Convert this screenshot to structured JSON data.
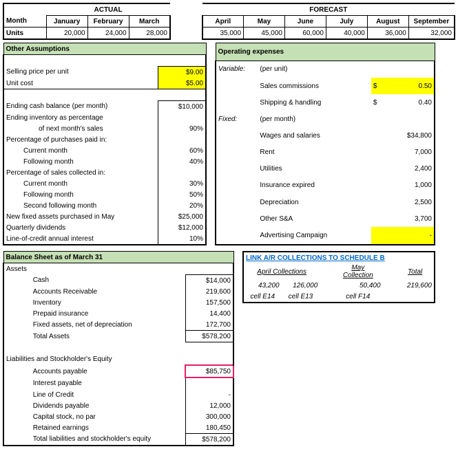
{
  "top": {
    "actual_label": "ACTUAL",
    "forecast_label": "FORECAST",
    "month_label": "Month",
    "units_label": "Units",
    "months": [
      "January",
      "February",
      "March",
      "April",
      "May",
      "June",
      "July",
      "August",
      "September"
    ],
    "units": [
      "20,000",
      "24,000",
      "28,000",
      "35,000",
      "45,000",
      "60,000",
      "40,000",
      "36,000",
      "32,000"
    ]
  },
  "assumptions": {
    "header": "Other Assumptions",
    "rows": {
      "sell_price": {
        "label": "Selling price per unit",
        "val": "$9.00"
      },
      "unit_cost": {
        "label": "Unit cost",
        "val": "$5.00"
      },
      "end_cash": {
        "label": "Ending cash balance (per month)",
        "val": "$10,000"
      },
      "end_inv": {
        "label": "Ending inventory as percentage",
        "val": ""
      },
      "end_inv2": {
        "label": "of next month's sales",
        "val": "90%"
      },
      "pct_purch": {
        "label": "Percentage of purchases paid in:",
        "val": ""
      },
      "cur_m": {
        "label": "Current month",
        "val": "60%"
      },
      "fol_m": {
        "label": "Following month",
        "val": "40%"
      },
      "pct_sales": {
        "label": "Percentage of sales collected in:",
        "val": ""
      },
      "s_cur": {
        "label": "Current month",
        "val": "30%"
      },
      "s_fol": {
        "label": "Following month",
        "val": "50%"
      },
      "s_sec": {
        "label": "Second following month",
        "val": "20%"
      },
      "new_fix": {
        "label": "New fixed assets purchased in May",
        "val": "$25,000"
      },
      "qdiv": {
        "label": "Quarterly dividends",
        "val": "$12,000"
      },
      "loc": {
        "label": "Line-of-credit annual interest",
        "val": "10%"
      }
    }
  },
  "opex": {
    "header": "Operating expenses",
    "variable_label": "Variable:",
    "per_unit": "(per unit)",
    "sales_comm": {
      "label": "Sales commissions",
      "cur": "$",
      "val": "0.50"
    },
    "ship": {
      "label": "Shipping & handling",
      "cur": "$",
      "val": "0.40"
    },
    "fixed_label": "Fixed:",
    "per_month": "(per month)",
    "wages": {
      "label": "Wages and salaries",
      "val": "$34,800"
    },
    "rent": {
      "label": "Rent",
      "val": "7,000"
    },
    "util": {
      "label": "Utilities",
      "val": "2,400"
    },
    "ins": {
      "label": "Insurance expired",
      "val": "1,000"
    },
    "dep": {
      "label": "Depreciation",
      "val": "2,500"
    },
    "osa": {
      "label": "Other S&A",
      "val": "3,700"
    },
    "adv": {
      "label": "Advertising Campaign",
      "val": "-"
    }
  },
  "balance": {
    "header": "Balance Sheet as of March 31",
    "assets_label": "Assets",
    "cash": {
      "label": "Cash",
      "val": "$14,000"
    },
    "ar": {
      "label": "Accounts Receivable",
      "val": "219,600"
    },
    "inv": {
      "label": "Inventory",
      "val": "157,500"
    },
    "ppi": {
      "label": "Prepaid insurance",
      "val": "14,400"
    },
    "fa": {
      "label": "Fixed assets, net of depreciation",
      "val": "172,700"
    },
    "ta": {
      "label": "Total Assets",
      "val": "$578,200"
    },
    "liab_label": "Liabilities and Stockholder's Equity",
    "ap": {
      "label": "Accounts payable",
      "val": "$85,750"
    },
    "ip": {
      "label": "Interest payable",
      "val": ""
    },
    "lc": {
      "label": "Line of Credit",
      "val": "-"
    },
    "dp": {
      "label": "Dividends payable",
      "val": "12,000"
    },
    "cs": {
      "label": "Capital stock, no par",
      "val": "300,000"
    },
    "re": {
      "label": "Retained earnings",
      "val": "180,450"
    },
    "tl": {
      "label": "Total liabilities and stockholder's equity",
      "val": "$578,200"
    }
  },
  "link": {
    "header": "LINK A/R COLLECTIONS TO SCHEDULE B",
    "apr_label": "April Collections",
    "may_label": "May Collection",
    "total_label": "Total",
    "apr1": "43,200",
    "apr2": "126,000",
    "may1": "50,400",
    "total": "219,600",
    "e14": "cell E14",
    "e13": "cell E13",
    "f14": "cell F14"
  }
}
